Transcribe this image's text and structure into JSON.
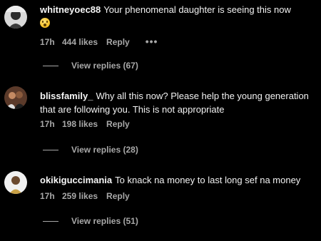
{
  "comments": [
    {
      "username": "whitneyoec88",
      "text": "Your phenomenal daughter is seeing this now",
      "emoji": "face-with-open-mouth-emoji",
      "time": "17h",
      "likes": "444 likes",
      "reply": "Reply",
      "more": "•••",
      "view_replies": "View replies (67)"
    },
    {
      "username": "blissfamily_",
      "text": "Why all this now? Please help the young generation that are following you. This is not appropriate",
      "time": "17h",
      "likes": "198 likes",
      "reply": "Reply",
      "view_replies": "View replies (28)"
    },
    {
      "username": "okikiguccimania",
      "text": "To knack na money to last long sef na money",
      "time": "17h",
      "likes": "259 likes",
      "reply": "Reply",
      "view_replies": "View replies (51)"
    }
  ]
}
